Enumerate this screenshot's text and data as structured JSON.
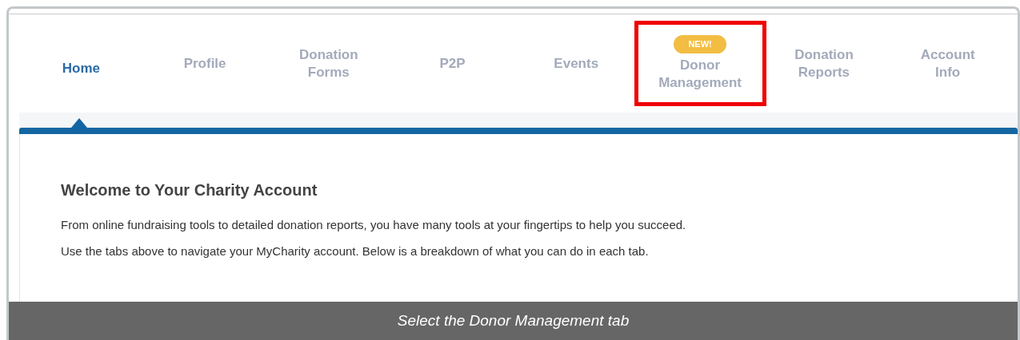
{
  "tabs": [
    {
      "label": "Home",
      "selected": true
    },
    {
      "label": "Profile",
      "selected": false
    },
    {
      "label": "Donation Forms",
      "selected": false
    },
    {
      "label": "P2P",
      "selected": false
    },
    {
      "label": "Events",
      "selected": false
    },
    {
      "label": "Donor Management",
      "selected": false,
      "badge": "NEW!",
      "highlighted": true
    },
    {
      "label": "Donation Reports",
      "selected": false
    },
    {
      "label": "Account Info",
      "selected": false
    }
  ],
  "content": {
    "heading": "Welcome to Your Charity Account",
    "paragraphs": [
      "From online fundraising tools to detailed donation reports, you have many tools at your fingertips to help you succeed.",
      "Use the tabs above to navigate your MyCharity account. Below is a breakdown of what you can do in each tab."
    ]
  },
  "caption": "Select the Donor Management tab"
}
